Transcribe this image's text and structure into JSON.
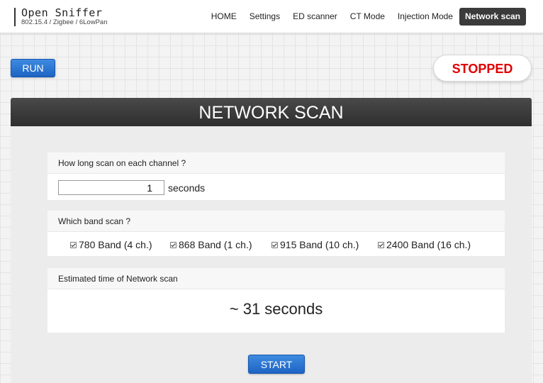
{
  "logo": {
    "title": "Open Sniffer",
    "subtitle": "802.15.4 / Zigbee / 6LowPan"
  },
  "nav": {
    "items": [
      {
        "label": "HOME"
      },
      {
        "label": "Settings"
      },
      {
        "label": "ED scanner"
      },
      {
        "label": "CT Mode"
      },
      {
        "label": "Injection Mode"
      },
      {
        "label": "Network scan",
        "active": true
      }
    ]
  },
  "controls": {
    "run_label": "RUN",
    "status": "STOPPED",
    "status_color": "#e00000"
  },
  "panel": {
    "title": "NETWORK SCAN",
    "duration": {
      "question": "How long scan on each channel ?",
      "value": "1",
      "unit": "seconds"
    },
    "bands": {
      "question": "Which band scan ?",
      "options": [
        {
          "label": "780 Band (4 ch.)",
          "checked": true
        },
        {
          "label": "868 Band (1 ch.)",
          "checked": true
        },
        {
          "label": "915 Band (10 ch.)",
          "checked": true
        },
        {
          "label": "2400 Band (16 ch.)",
          "checked": true
        }
      ]
    },
    "estimate": {
      "label": "Estimated time of Network scan",
      "value": "~ 31 seconds"
    },
    "start_label": "START"
  },
  "colors": {
    "accent": "#1d64c4",
    "header_dark": "#3b3b3b"
  }
}
